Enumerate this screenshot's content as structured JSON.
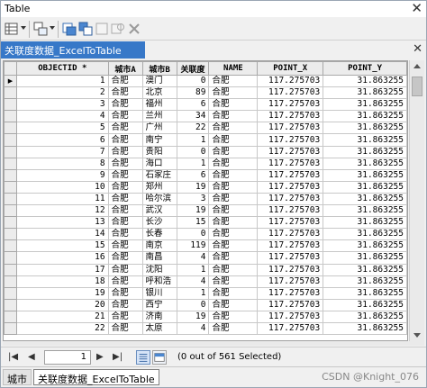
{
  "window": {
    "title": "Table",
    "close_glyph": "✕"
  },
  "toolbar": {
    "icons": [
      "table-options-icon",
      "related-tables-icon",
      "select-by-attributes-icon",
      "switch-selection-icon",
      "clear-selection-icon",
      "zoom-to-selected-icon",
      "delete-selected-icon"
    ]
  },
  "tab": {
    "label": "关联度数据_ExcelToTable",
    "close_glyph": "✕"
  },
  "table": {
    "columns": [
      "OBJECTID *",
      "城市A",
      "城市B",
      "关联度",
      "NAME",
      "POINT_X",
      "POINT_Y"
    ],
    "rows": [
      [
        "1",
        "合肥",
        "澳门",
        "0",
        "合肥",
        "117.275703",
        "31.863255"
      ],
      [
        "2",
        "合肥",
        "北京",
        "89",
        "合肥",
        "117.275703",
        "31.863255"
      ],
      [
        "3",
        "合肥",
        "福州",
        "6",
        "合肥",
        "117.275703",
        "31.863255"
      ],
      [
        "4",
        "合肥",
        "兰州",
        "34",
        "合肥",
        "117.275703",
        "31.863255"
      ],
      [
        "5",
        "合肥",
        "广州",
        "22",
        "合肥",
        "117.275703",
        "31.863255"
      ],
      [
        "6",
        "合肥",
        "南宁",
        "1",
        "合肥",
        "117.275703",
        "31.863255"
      ],
      [
        "7",
        "合肥",
        "贵阳",
        "0",
        "合肥",
        "117.275703",
        "31.863255"
      ],
      [
        "8",
        "合肥",
        "海口",
        "1",
        "合肥",
        "117.275703",
        "31.863255"
      ],
      [
        "9",
        "合肥",
        "石家庄",
        "6",
        "合肥",
        "117.275703",
        "31.863255"
      ],
      [
        "10",
        "合肥",
        "郑州",
        "19",
        "合肥",
        "117.275703",
        "31.863255"
      ],
      [
        "11",
        "合肥",
        "哈尔滨",
        "3",
        "合肥",
        "117.275703",
        "31.863255"
      ],
      [
        "12",
        "合肥",
        "武汉",
        "19",
        "合肥",
        "117.275703",
        "31.863255"
      ],
      [
        "13",
        "合肥",
        "长沙",
        "15",
        "合肥",
        "117.275703",
        "31.863255"
      ],
      [
        "14",
        "合肥",
        "长春",
        "0",
        "合肥",
        "117.275703",
        "31.863255"
      ],
      [
        "15",
        "合肥",
        "南京",
        "119",
        "合肥",
        "117.275703",
        "31.863255"
      ],
      [
        "16",
        "合肥",
        "南昌",
        "4",
        "合肥",
        "117.275703",
        "31.863255"
      ],
      [
        "17",
        "合肥",
        "沈阳",
        "1",
        "合肥",
        "117.275703",
        "31.863255"
      ],
      [
        "18",
        "合肥",
        "呼和浩",
        "4",
        "合肥",
        "117.275703",
        "31.863255"
      ],
      [
        "19",
        "合肥",
        "银川",
        "1",
        "合肥",
        "117.275703",
        "31.863255"
      ],
      [
        "20",
        "合肥",
        "西宁",
        "0",
        "合肥",
        "117.275703",
        "31.863255"
      ],
      [
        "21",
        "合肥",
        "济南",
        "19",
        "合肥",
        "117.275703",
        "31.863255"
      ],
      [
        "22",
        "合肥",
        "太原",
        "4",
        "合肥",
        "117.275703",
        "31.863255"
      ]
    ],
    "current_row_marker": "▶"
  },
  "status": {
    "first": "|◀",
    "prev": "◀",
    "position": "1",
    "next": "▶",
    "last": "▶|",
    "selection": "(0 out of 561 Selected)"
  },
  "bottom_tabs": {
    "tab1": "城市",
    "tab2": "关联度数据_ExcelToTable"
  },
  "watermark": "CSDN @Knight_076"
}
